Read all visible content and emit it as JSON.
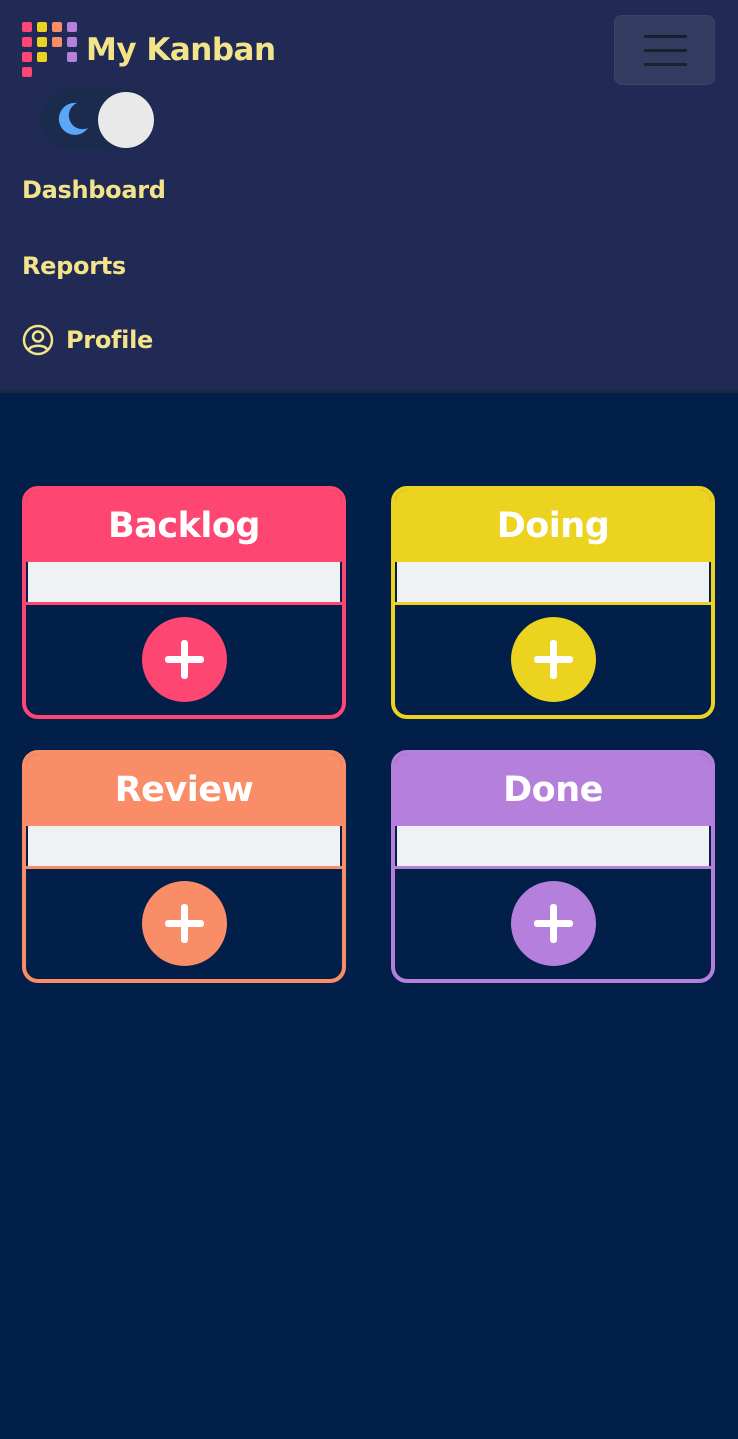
{
  "app": {
    "title": "My Kanban"
  },
  "nav": {
    "links": [
      {
        "label": "Dashboard"
      },
      {
        "label": "Reports"
      },
      {
        "label": "Profile"
      }
    ]
  },
  "theme": {
    "mode": "dark"
  },
  "board": {
    "columns": [
      {
        "title": "Backlog",
        "color": "#fe4673"
      },
      {
        "title": "Doing",
        "color": "#ebd31f"
      },
      {
        "title": "Review",
        "color": "#f98d67"
      },
      {
        "title": "Done",
        "color": "#b480dc"
      }
    ]
  },
  "colors": {
    "background": "#011f48",
    "navbar": "#212a55",
    "accent_text": "#f3e48a"
  }
}
